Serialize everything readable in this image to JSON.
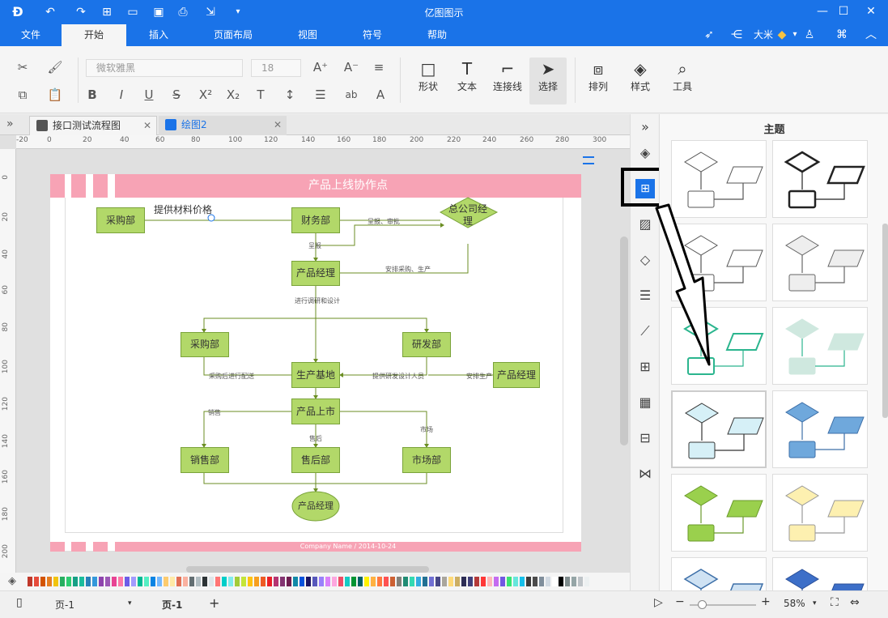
{
  "app": {
    "title": "亿图图示"
  },
  "menu": {
    "items": [
      "文件",
      "开始",
      "插入",
      "页面布局",
      "视图",
      "符号",
      "帮助"
    ],
    "active": "开始"
  },
  "user": {
    "name": "大米"
  },
  "ribbon": {
    "font_name": "微软雅黑",
    "font_size": "18",
    "tools": {
      "shape": "形状",
      "text": "文本",
      "connector": "连接线",
      "select": "选择",
      "arrange": "排列",
      "style": "样式",
      "tool": "工具"
    }
  },
  "tabs": [
    {
      "label": "接口测试流程图"
    },
    {
      "label": "绘图2"
    }
  ],
  "ruler": {
    "h": [
      "-20",
      "0",
      "20",
      "40",
      "60",
      "80",
      "100",
      "120",
      "140",
      "160",
      "180",
      "200",
      "220",
      "240",
      "260",
      "280",
      "300"
    ],
    "v": [
      "0",
      "20",
      "40",
      "60",
      "80",
      "100",
      "120",
      "140",
      "160",
      "180",
      "200"
    ]
  },
  "diagram": {
    "title": "产品上线协作点",
    "footer": "Company Name / 2014-10-24",
    "nodes": {
      "n1": "采购部",
      "n2": "财务部",
      "n3": "总公司经理",
      "n4": "产品经理",
      "n5": "采购部",
      "n6": "研发部",
      "n7": "生产基地",
      "n8": "产品经理",
      "n9": "产品上市",
      "n10": "销售部",
      "n11": "售后部",
      "n12": "市场部",
      "n13": "产品经理"
    },
    "edge_labels": {
      "e1": "提供材料价格",
      "e2": "呈报、审批",
      "e3": "呈报",
      "e4": "安排采购、生产",
      "e5": "进行调研和设计",
      "e6": "采购后进行配送",
      "e7": "提供研发设计人员",
      "e8": "安排生产",
      "e9": "销售",
      "e10": "售后",
      "e11": "市场"
    }
  },
  "theme_panel": {
    "title": "主题",
    "selected_index": 6
  },
  "status": {
    "page_select": "页-1",
    "page_tab": "页-1",
    "zoom": "58%"
  },
  "colors": {
    "titlebar": "#1a73e8",
    "banner": "#f7a3b5",
    "node_fill": "#b2d869",
    "node_border": "#7aa33a",
    "accent": "#1a73e8"
  },
  "swatch_colors": [
    "#c0392b",
    "#e74c3c",
    "#d35400",
    "#e67e22",
    "#f1c40f",
    "#27ae60",
    "#2ecc71",
    "#16a085",
    "#1abc9c",
    "#2980b9",
    "#3498db",
    "#8e44ad",
    "#9b59b6",
    "#e84393",
    "#fd79a8",
    "#6c5ce7",
    "#a29bfe",
    "#00b894",
    "#55efc4",
    "#0984e3",
    "#74b9ff",
    "#fdcb6e",
    "#ffeaa7",
    "#e17055",
    "#fab1a0",
    "#636e72",
    "#b2bec3",
    "#2d3436",
    "#dfe6e9",
    "#ff7675",
    "#00cec9",
    "#81ecec",
    "#a3cb38",
    "#c4e538",
    "#ffc312",
    "#f79f1f",
    "#ee5a24",
    "#ea2027",
    "#b53471",
    "#833471",
    "#6f1e51",
    "#1289a7",
    "#0652dd",
    "#1b1464",
    "#5758bb",
    "#9980fa",
    "#d980fa",
    "#fda7df",
    "#ed4c67",
    "#12cbc4",
    "#009432",
    "#006266",
    "#fff200",
    "#ffb142",
    "#ff793f",
    "#ff5252",
    "#cd6133",
    "#84817a",
    "#218c74",
    "#33d9b2",
    "#34ace0",
    "#227093",
    "#706fd3",
    "#474787",
    "#aaa69d",
    "#ffda79",
    "#ccae62",
    "#2c2c54",
    "#40407a",
    "#b33939",
    "#ff3838",
    "#ffb8b8",
    "#c56cf0",
    "#7158e2",
    "#3ae374",
    "#67e6dc",
    "#17c0eb",
    "#3d3d3d",
    "#4b4b4b",
    "#808e9b",
    "#d2dae2",
    "#ffffff",
    "#000000",
    "#7f8c8d",
    "#95a5a6",
    "#bdc3c7",
    "#ecf0f1"
  ]
}
